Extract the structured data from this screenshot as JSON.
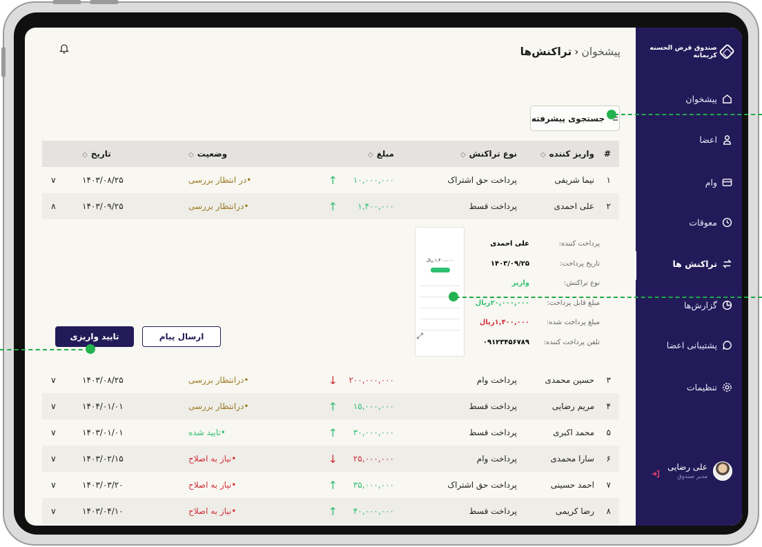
{
  "app": {
    "name": "صندوق قرض الحسنه کریمانه"
  },
  "breadcrumb": {
    "parent": "پیشخوان",
    "current": "تراکنش‌ها"
  },
  "sidebar": {
    "items": [
      {
        "label": "پیشخوان",
        "icon": "home-icon"
      },
      {
        "label": "اعضا",
        "icon": "user-icon"
      },
      {
        "label": "وام",
        "icon": "card-icon"
      },
      {
        "label": "معوقات",
        "icon": "clock-icon"
      },
      {
        "label": "تراکنش ها",
        "icon": "transfer-icon",
        "active": true
      },
      {
        "label": "گزارش‌ها",
        "icon": "pie-chart-icon"
      },
      {
        "label": "پشتیبانی اعضا",
        "icon": "chat-icon"
      },
      {
        "label": "تنظیمات",
        "icon": "gear-icon"
      }
    ]
  },
  "profile": {
    "name": "علی رضایی",
    "role": "مدیر صندوق"
  },
  "search": {
    "advanced_label": "جستجوی پیشرفته"
  },
  "table": {
    "headers": {
      "num": "#",
      "payer": "واریز کننده",
      "type": "نوع تراکنش",
      "amount": "مبلغ",
      "status": "وضعیت",
      "date": "تاریخ"
    },
    "rows": [
      {
        "num": "۱",
        "payer": "نیما شریفی",
        "type": "پرداخت حق اشتراک",
        "amount": "۱۰,۰۰۰,۰۰۰",
        "direction": "up",
        "status": "•در انتظار بررسی",
        "date": "۱۴۰۳/۰۸/۲۵"
      },
      {
        "num": "۲",
        "payer": "علی احمدی",
        "type": "پرداخت قسط",
        "amount": "۱,۴۰۰,۰۰۰",
        "direction": "up",
        "status": "•درانتظار بررسی",
        "date": "۱۴۰۳/۰۹/۲۵"
      },
      {
        "num": "۳",
        "payer": "حسین محمدی",
        "type": "پرداخت وام",
        "amount": "۲۰۰,۰۰۰,۰۰۰",
        "direction": "down",
        "status": "•درانتظار بررسی",
        "date": "۱۴۰۳/۰۸/۲۵"
      },
      {
        "num": "۴",
        "payer": "مریم رضایی",
        "type": "پرداخت قسط",
        "amount": "۱۵,۰۰۰,۰۰۰",
        "direction": "up",
        "status": "•درانتظار بررسی",
        "date": "۱۴۰۴/۰۱/۰۱"
      },
      {
        "num": "۵",
        "payer": "محمد اکبری",
        "type": "پرداخت قسط",
        "amount": "۳۰,۰۰۰,۰۰۰",
        "direction": "up",
        "status": "•تایید شده",
        "date": "۱۴۰۳/۰۱/۰۱"
      },
      {
        "num": "۶",
        "payer": "سارا محمدی",
        "type": "پرداخت وام",
        "amount": "۲۵,۰۰۰,۰۰۰",
        "direction": "down",
        "status": "•نیاز به اصلاح",
        "date": "۱۴۰۳/۰۲/۱۵"
      },
      {
        "num": "۷",
        "payer": "احمد حسینی",
        "type": "پرداخت حق اشتراک",
        "amount": "۳۵,۰۰۰,۰۰۰",
        "direction": "up",
        "status": "•نیاز به اصلاح",
        "date": "۱۴۰۳/۰۳/۲۰"
      },
      {
        "num": "۸",
        "payer": "رضا کریمی",
        "type": "پرداخت قسط",
        "amount": "۴۰,۰۰۰,۰۰۰",
        "direction": "up",
        "status": "•نیاز به اصلاح",
        "date": "۱۴۰۳/۰۴/۱۰"
      }
    ]
  },
  "detail": {
    "labels": [
      "پرداخت کننده:",
      "تاریخ پرداخت:",
      "نوع تراکنش:",
      "مبلغ قابل پرداخت:",
      "مبلغ پرداخت شده:",
      "تلفن پرداخت کننده:"
    ],
    "values": [
      "علی احمدی",
      "۱۴۰۳/۰۹/۲۵",
      "واریز",
      "۲۰,۰۰۰,۰۰۰ریال",
      "۱,۴۰۰,۰۰۰ریال",
      "۰۹۱۲۳۴۵۶۷۸۹"
    ],
    "receipt_amount": "۱,۴۰۰,۰۰۰ ریال",
    "send_message_label": "ارسال پیام",
    "confirm_label": "تایید واریزی"
  },
  "colors": {
    "sidebar": "#231b59",
    "accent_green": "#2fbf71",
    "accent_red": "#d32f3a",
    "pending": "#9a7a22"
  }
}
